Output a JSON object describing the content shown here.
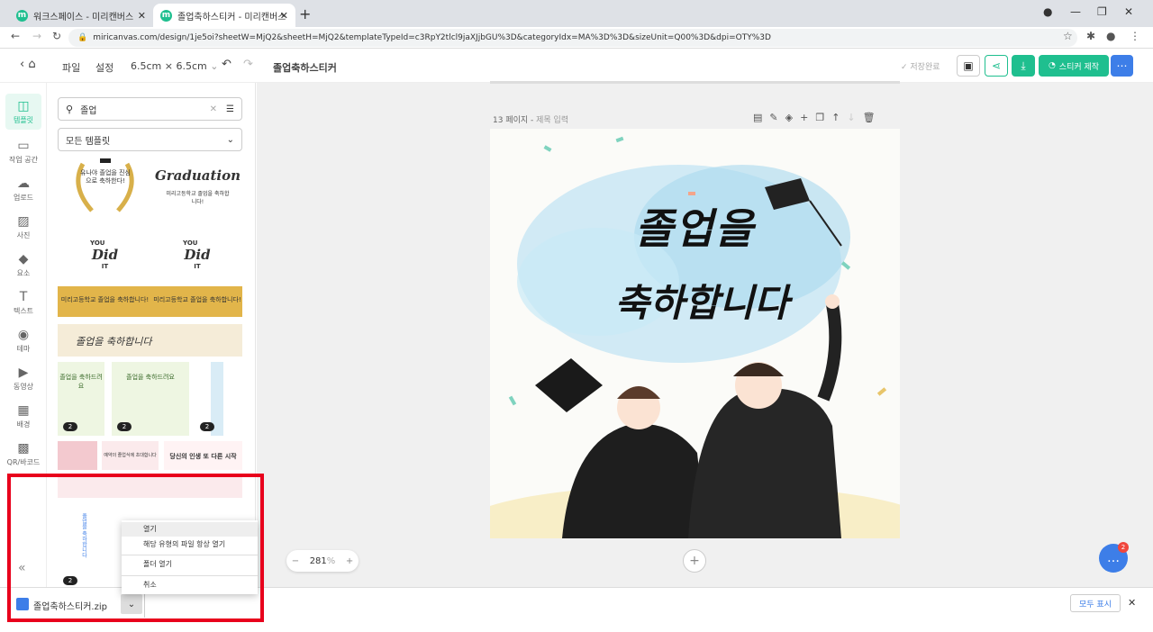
{
  "browser": {
    "tabs": [
      {
        "title": "워크스페이스 - 미리캔버스",
        "active": false
      },
      {
        "title": "졸업축하스티커 - 미리캔버스",
        "active": true
      }
    ],
    "url": "miricanvas.com/design/1je5oi?sheetW=MjQ2&sheetH=MjQ2&templateTypeId=c3RpY2tlcl9jaXJjbGU%3D&categoryIdx=MA%3D%3D&sizeUnit=Q00%3D&dpi=OTY%3D",
    "favicon_letter": "m"
  },
  "header": {
    "menu_file": "파일",
    "menu_settings": "설정",
    "size": "6.5cm × 6.5cm",
    "doc_title": "졸업축하스티커",
    "saved_label": "저장완료",
    "make_sticker": "스티커 제작"
  },
  "sidebar": {
    "items": [
      {
        "label": "템플릿",
        "icon": "template-icon",
        "glyph": "◫",
        "active": true
      },
      {
        "label": "작업 공간",
        "icon": "workspace-icon",
        "glyph": "▭"
      },
      {
        "label": "업로드",
        "icon": "upload-icon",
        "glyph": "☁"
      },
      {
        "label": "사진",
        "icon": "photo-icon",
        "glyph": "▨"
      },
      {
        "label": "요소",
        "icon": "elements-icon",
        "glyph": "◆"
      },
      {
        "label": "텍스트",
        "icon": "text-icon",
        "glyph": "T"
      },
      {
        "label": "테마",
        "icon": "theme-icon",
        "glyph": "◉"
      },
      {
        "label": "동영상",
        "icon": "video-icon",
        "glyph": "▶"
      },
      {
        "label": "배경",
        "icon": "background-icon",
        "glyph": "▦"
      },
      {
        "label": "QR/바코드",
        "icon": "qr-icon",
        "glyph": "▩"
      }
    ]
  },
  "panel": {
    "search_value": "졸업",
    "category": "모든 템플릿",
    "thumbs": {
      "t1": "유나야 졸업을 진심으로 축하한다!",
      "t2": "Graduation",
      "t2_sub": "미리고등학교 졸업을 축하합니다!",
      "you": "YOU",
      "did": "Did",
      "it": "IT",
      "congrats": "미리고등학교 졸업을 축하합니다!",
      "banner": "졸업을 축하합니다",
      "green": "졸업을 축하드려요",
      "pink_banner": "당신의 인생 또 다른 시작",
      "pink_small": "예약의 졸업식에 초대합니다"
    },
    "badge": "2"
  },
  "canvas": {
    "page_number": "13 페이지",
    "page_title_placeholder": "제목 입력",
    "headline_1": "졸업을",
    "headline_2": "축하합니다",
    "zoom": "281",
    "zoom_unit": "%"
  },
  "context_menu": {
    "items": [
      "열기",
      "해당 유형의 파일 항상 열기",
      "폴더 열기",
      "취소"
    ]
  },
  "downloads": {
    "file_name": "졸업축하스티커.zip",
    "show_all": "모두 표시"
  },
  "chat_badge": "2",
  "colors": {
    "accent": "#1fbf8f",
    "primary_blue": "#3d7ee8",
    "highlight_red": "#e8001c",
    "gold": "#e2b54a"
  }
}
